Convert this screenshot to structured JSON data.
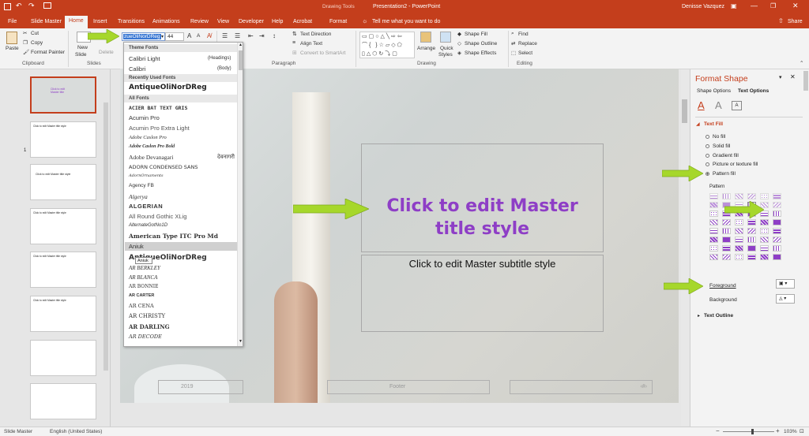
{
  "title_bar": {
    "context": "Drawing Tools",
    "doc_title": "Presentation2 - PowerPoint",
    "user": "Denisse Vazquez"
  },
  "tabs": [
    "File",
    "Slide Master",
    "Home",
    "Insert",
    "Transitions",
    "Animations",
    "Review",
    "View",
    "Developer",
    "Help",
    "Acrobat",
    "Format"
  ],
  "tell_me": "Tell me what you want to do",
  "share": "Share",
  "ribbon": {
    "clipboard": {
      "paste": "Paste",
      "cut": "Cut",
      "copy": "Copy",
      "format_painter": "Format Painter",
      "label": "Clipboard"
    },
    "slides": {
      "new_slide": "New",
      "new_slide2": "Slide",
      "delete": "Delete",
      "label": "Slides"
    },
    "font": {
      "name_value": "zueOliNorDReg",
      "size": "44"
    },
    "paragraph": {
      "text_direction": "Text Direction",
      "align_text": "Align Text",
      "smartart": "Convert to SmartArt",
      "label": "Paragraph"
    },
    "drawing": {
      "arrange": "Arrange",
      "quick_styles": "Quick",
      "quick_styles2": "Styles",
      "shape_fill": "Shape Fill",
      "shape_outline": "Shape Outline",
      "shape_effects": "Shape Effects",
      "label": "Drawing"
    },
    "editing": {
      "find": "Find",
      "replace": "Replace",
      "select": "Select",
      "label": "Editing"
    }
  },
  "font_dropdown": {
    "theme_header": "Theme Fonts",
    "theme": [
      {
        "name": "Calibri Light",
        "tag": "(Headings)"
      },
      {
        "name": "Calibri",
        "tag": "(Body)"
      }
    ],
    "recent_header": "Recently Used Fonts",
    "recent": [
      "AntiqueOliNorDReg"
    ],
    "all_header": "All Fonts",
    "all": [
      "ACIER BAT TEXT GRIS",
      "Acumin Pro",
      "Acumin Pro Extra Light",
      "Adobe Caslon Pro",
      "Adobe Caslon Pro Bold",
      "Adobe Devanagari",
      "ADORN CONDENSED SANS",
      "AdornOrnaments",
      "Agency FB",
      "Algerya",
      "ALGERIAN",
      "All Round Gothic XLig",
      "AlternateGotNo1D",
      "American Type ITC Pro Md",
      "Aniuk",
      "AntiqueOliNorDReg",
      "AR BERKLEY",
      "AR BLANCA",
      "AR BONNIE",
      "AR CARTER",
      "AR CENA",
      "AR CHRISTY",
      "AR DARLING",
      "AR DECODE"
    ],
    "devanagari_sample": "देवनागरी",
    "tooltip": "Aniuk"
  },
  "thumb_texts": [
    "Click to edit Master title style",
    "Click to edit Master title style",
    "Click to edit Master title style",
    "Click to edit Master title style",
    "Click to edit Master title style"
  ],
  "slide": {
    "title_line1": "Click to edit Master",
    "title_line2": "title style",
    "subtitle": "Click to edit Master subtitle style",
    "date": "2019",
    "footer": "Footer",
    "page": "‹#›"
  },
  "format_pane": {
    "title": "Format Shape",
    "tab1": "Shape Options",
    "tab2": "Text Options",
    "section": "Text Fill",
    "options": [
      "No fill",
      "Solid fill",
      "Gradient fill",
      "Picture or texture fill",
      "Pattern fill"
    ],
    "selected": "Pattern fill",
    "pattern_label": "Pattern",
    "foreground": "Foreground",
    "background": "Background",
    "outline": "Text Outline"
  },
  "status": {
    "view": "Slide Master",
    "language": "English (United States)",
    "zoom": "103%"
  },
  "colors": {
    "accent": "#c43e1c",
    "arrow": "#a6d72b",
    "title_purple": "#8e3ec6"
  }
}
